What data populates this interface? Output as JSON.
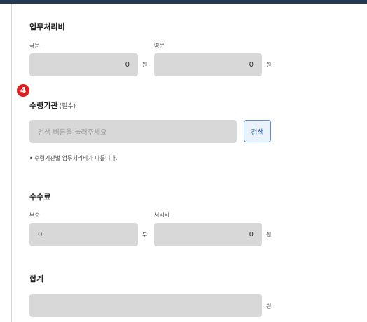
{
  "work_fee": {
    "title": "업무처리비",
    "korean_label": "국문",
    "korean_value": "0",
    "korean_unit": "원",
    "english_label": "영문",
    "english_value": "0",
    "english_unit": "원"
  },
  "recipient": {
    "step_number": "4",
    "title": "수령기관",
    "required_text": "(필수)",
    "search_placeholder": "검색 버튼을 눌러주세요",
    "search_button": "검색",
    "note": "• 수령기관별 업무처리비가 다릅니다."
  },
  "fee": {
    "title": "수수료",
    "copies_label": "부수",
    "copies_value": "0",
    "copies_unit": "부",
    "processing_label": "처리비",
    "processing_value": "0",
    "processing_unit": "원"
  },
  "total": {
    "title": "합계",
    "value": "",
    "unit": "원"
  }
}
